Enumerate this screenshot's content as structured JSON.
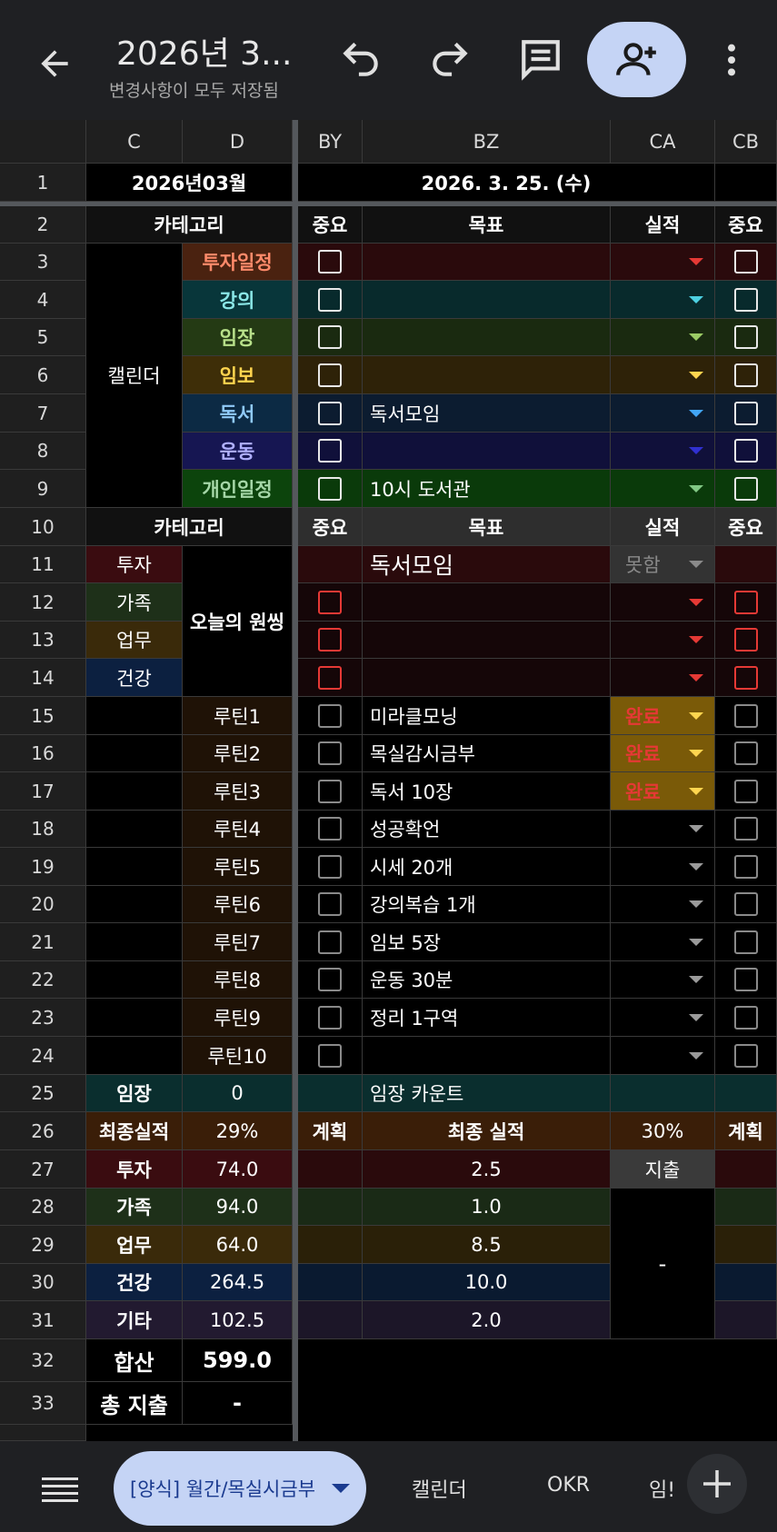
{
  "header": {
    "title": "2026년 3...",
    "subtitle": "변경사항이 모두 저장됨"
  },
  "columns": [
    "C",
    "D",
    "BY",
    "BZ",
    "CA",
    "CB"
  ],
  "cells": {
    "r1": {
      "cd": "2026년03월",
      "date": "2026. 3. 25. (수)"
    },
    "r2": {
      "cat": "카테고리",
      "imp": "중요",
      "goal": "목표",
      "res": "실적",
      "imp2": "중요"
    },
    "calendar_label": "캘린더",
    "calendar_rows": [
      {
        "cat": "투자일정",
        "goal": ""
      },
      {
        "cat": "강의",
        "goal": ""
      },
      {
        "cat": "임장",
        "goal": ""
      },
      {
        "cat": "임보",
        "goal": ""
      },
      {
        "cat": "독서",
        "goal": "독서모임"
      },
      {
        "cat": "운동",
        "goal": ""
      },
      {
        "cat": "개인일정",
        "goal": "10시 도서관"
      }
    ],
    "r10": {
      "cat": "카테고리",
      "imp": "중요",
      "goal": "목표",
      "res": "실적",
      "imp2": "중요"
    },
    "one_thing_label": "오늘의 원씽",
    "r11": {
      "c": "투자",
      "goal": "독서모임",
      "res": "못함"
    },
    "r12": {
      "c": "가족"
    },
    "r13": {
      "c": "업무"
    },
    "r14": {
      "c": "건강"
    },
    "routines": [
      {
        "d": "루틴1",
        "goal": "미라클모닝",
        "res": "완료"
      },
      {
        "d": "루틴2",
        "goal": "목실감시금부",
        "res": "완료"
      },
      {
        "d": "루틴3",
        "goal": "독서 10장",
        "res": "완료"
      },
      {
        "d": "루틴4",
        "goal": "성공확언",
        "res": ""
      },
      {
        "d": "루틴5",
        "goal": "시세  20개",
        "res": ""
      },
      {
        "d": "루틴6",
        "goal": "강의복습 1개",
        "res": ""
      },
      {
        "d": "루틴7",
        "goal": "임보 5장",
        "res": ""
      },
      {
        "d": "루틴8",
        "goal": "운동 30분",
        "res": ""
      },
      {
        "d": "루틴9",
        "goal": "정리 1구역",
        "res": ""
      },
      {
        "d": "루틴10",
        "goal": "",
        "res": ""
      }
    ],
    "r25": {
      "c": "임장",
      "d": "0",
      "goal": "임장 카운트"
    },
    "r26": {
      "c": "최종실적",
      "d": "29%",
      "by": "계획",
      "bz": "최종 실적",
      "ca": "30%",
      "cb": "계획"
    },
    "summary": [
      {
        "c": "투자",
        "d": "74.0",
        "bz": "2.5"
      },
      {
        "c": "가족",
        "d": "94.0",
        "bz": "1.0"
      },
      {
        "c": "업무",
        "d": "64.0",
        "bz": "8.5"
      },
      {
        "c": "건강",
        "d": "264.5",
        "bz": "10.0"
      },
      {
        "c": "기타",
        "d": "102.5",
        "bz": "2.0"
      }
    ],
    "ca27": "지출",
    "ca_merged": "-",
    "r32": {
      "c": "합산",
      "d": "599.0"
    },
    "r33": {
      "c": "총 지출",
      "d": "-"
    }
  },
  "bottom": {
    "sheet": "[양식] 월간/목실시금부",
    "tabs": [
      "캘린더",
      "OKR",
      "임!"
    ]
  },
  "colors": {
    "invest": "#2a0a0c",
    "lecture": "#082a2c",
    "field": "#1a2a10",
    "report": "#2e2208",
    "reading": "#0c1c30",
    "exercise": "#10103a",
    "personal": "#0a3a0a",
    "done": "#7a5a08",
    "done_text": "#e53935"
  },
  "icons": [
    "back-arrow-icon",
    "undo-icon",
    "redo-icon",
    "comment-icon",
    "add-person-icon",
    "more-vert-icon",
    "menu-icon",
    "caret-down-icon",
    "plus-icon"
  ]
}
